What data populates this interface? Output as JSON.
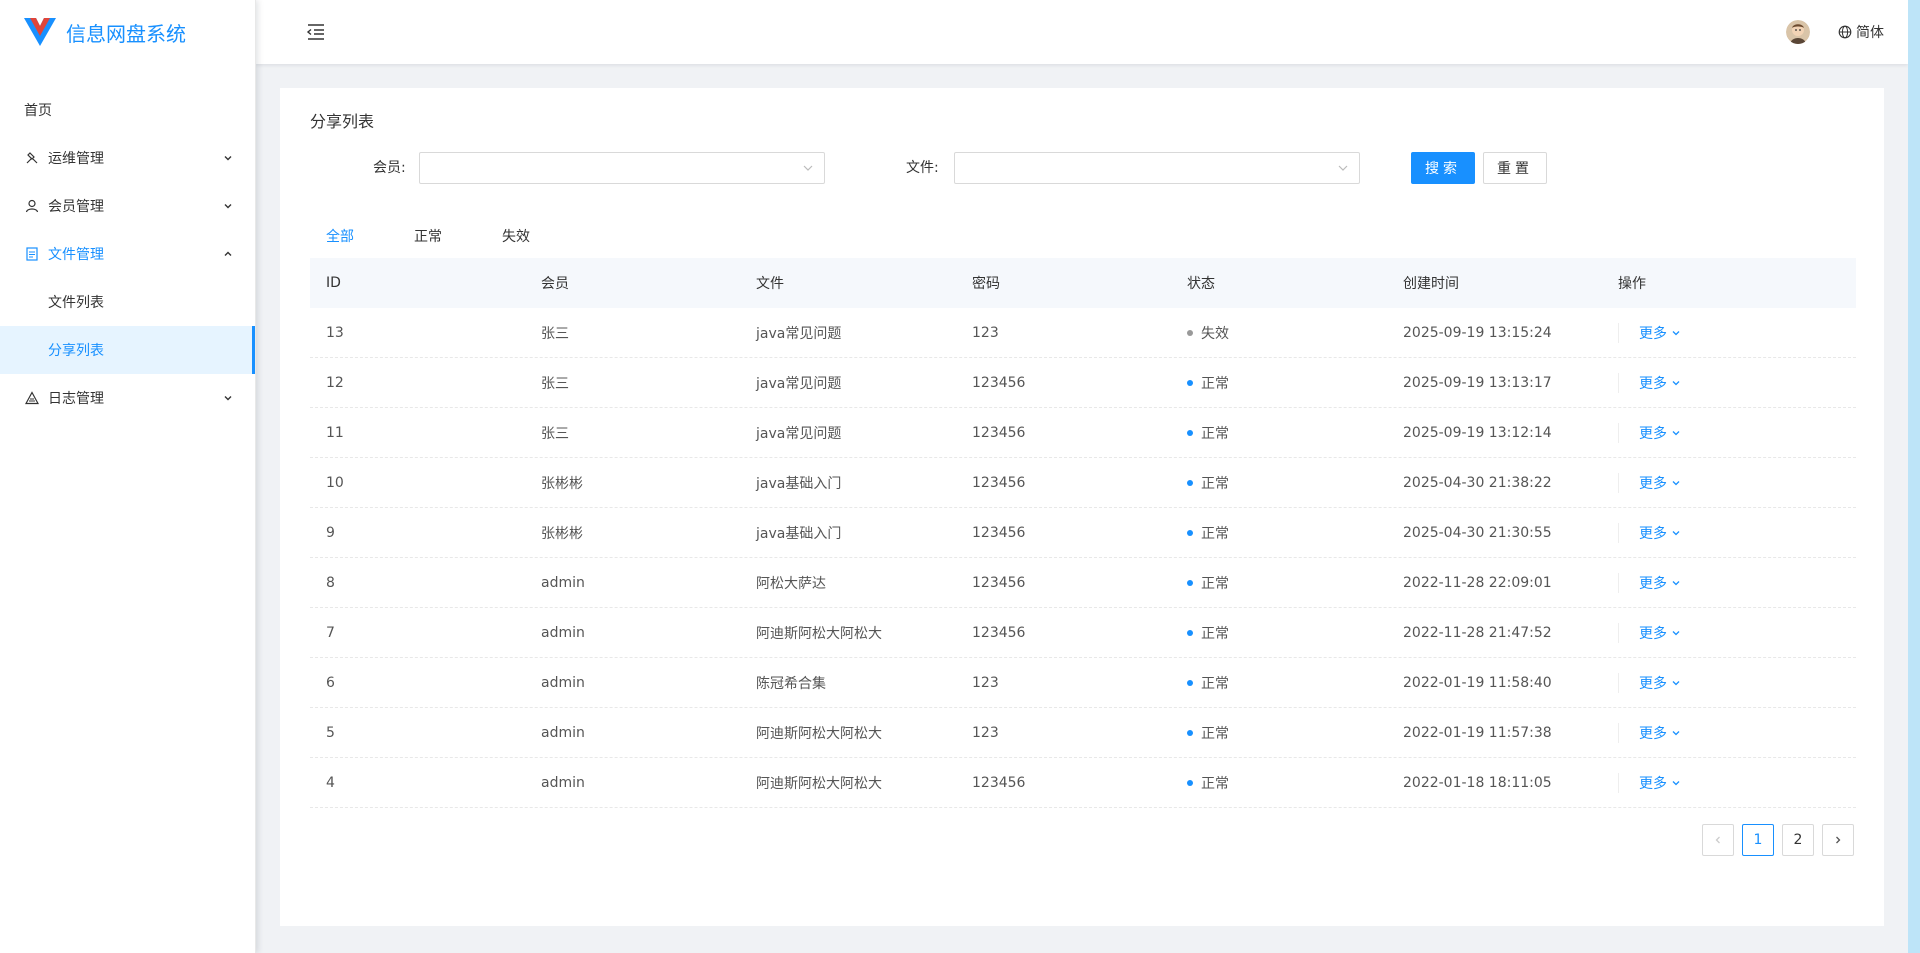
{
  "app": {
    "title": "信息网盘系统"
  },
  "sidebar": {
    "items": [
      {
        "label": "首页"
      },
      {
        "label": "运维管理"
      },
      {
        "label": "会员管理"
      },
      {
        "label": "文件管理"
      },
      {
        "label": "日志管理"
      }
    ],
    "file_sub": [
      {
        "label": "文件列表"
      },
      {
        "label": "分享列表"
      }
    ]
  },
  "header": {
    "lang": "简体"
  },
  "page": {
    "title": "分享列表",
    "search": {
      "member_label": "会员:",
      "file_label": "文件:",
      "member_value": "",
      "file_value": "",
      "search_btn": "搜索",
      "reset_btn": "重置"
    },
    "tabs": [
      "全部",
      "正常",
      "失效"
    ],
    "active_tab": "全部",
    "columns": [
      "ID",
      "会员",
      "文件",
      "密码",
      "状态",
      "创建时间",
      "操作"
    ],
    "rows": [
      {
        "id": "13",
        "member": "张三",
        "file": "java常见问题",
        "password": "123",
        "status": "失效",
        "created": "2025-09-19 13:15:24",
        "action": "更多"
      },
      {
        "id": "12",
        "member": "张三",
        "file": "java常见问题",
        "password": "123456",
        "status": "正常",
        "created": "2025-09-19 13:13:17",
        "action": "更多"
      },
      {
        "id": "11",
        "member": "张三",
        "file": "java常见问题",
        "password": "123456",
        "status": "正常",
        "created": "2025-09-19 13:12:14",
        "action": "更多"
      },
      {
        "id": "10",
        "member": "张彬彬",
        "file": "java基础入门",
        "password": "123456",
        "status": "正常",
        "created": "2025-04-30 21:38:22",
        "action": "更多"
      },
      {
        "id": "9",
        "member": "张彬彬",
        "file": "java基础入门",
        "password": "123456",
        "status": "正常",
        "created": "2025-04-30 21:30:55",
        "action": "更多"
      },
      {
        "id": "8",
        "member": "admin",
        "file": "阿松大萨达",
        "password": "123456",
        "status": "正常",
        "created": "2022-11-28 22:09:01",
        "action": "更多"
      },
      {
        "id": "7",
        "member": "admin",
        "file": "阿迪斯阿松大阿松大",
        "password": "123456",
        "status": "正常",
        "created": "2022-11-28 21:47:52",
        "action": "更多"
      },
      {
        "id": "6",
        "member": "admin",
        "file": "陈冠希合集",
        "password": "123",
        "status": "正常",
        "created": "2022-01-19 11:58:40",
        "action": "更多"
      },
      {
        "id": "5",
        "member": "admin",
        "file": "阿迪斯阿松大阿松大",
        "password": "123",
        "status": "正常",
        "created": "2022-01-19 11:57:38",
        "action": "更多"
      },
      {
        "id": "4",
        "member": "admin",
        "file": "阿迪斯阿松大阿松大",
        "password": "123456",
        "status": "正常",
        "created": "2022-01-18 18:11:05",
        "action": "更多"
      }
    ],
    "pagination": {
      "pages": [
        "1",
        "2"
      ],
      "current": "1"
    }
  },
  "colors": {
    "accent": "#1890ff",
    "status_normal": "#1890ff",
    "status_invalid": "#999999"
  },
  "icons": {
    "logo": "v-logo",
    "menu_collapse": "menu-fold-icon",
    "lang": "globe-icon"
  }
}
